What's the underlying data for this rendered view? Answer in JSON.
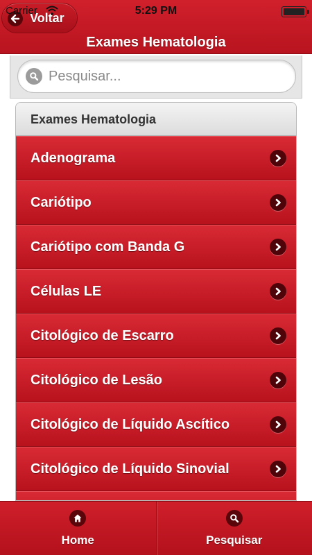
{
  "status_bar": {
    "carrier": "Carrier",
    "time": "5:29 PM"
  },
  "header": {
    "title": "Exames Hematologia",
    "back_label": "Voltar"
  },
  "search": {
    "placeholder": "Pesquisar..."
  },
  "list": {
    "header": "Exames Hematologia",
    "items": [
      "Adenograma",
      "Cariótipo",
      "Cariótipo com Banda G",
      "Células LE",
      "Citológico de Escarro",
      "Citológico de Lesão",
      "Citológico de Líquido Ascítico",
      "Citológico de Líquido Sinovial",
      ""
    ]
  },
  "tab_bar": {
    "home": "Home",
    "search": "Pesquisar"
  },
  "colors": {
    "brand_red": "#c41a25",
    "dark_red": "#5a0509"
  },
  "icons": {
    "back": "back-arrow-icon",
    "search": "search-icon",
    "chevron": "chevron-right-icon",
    "home": "home-icon"
  }
}
